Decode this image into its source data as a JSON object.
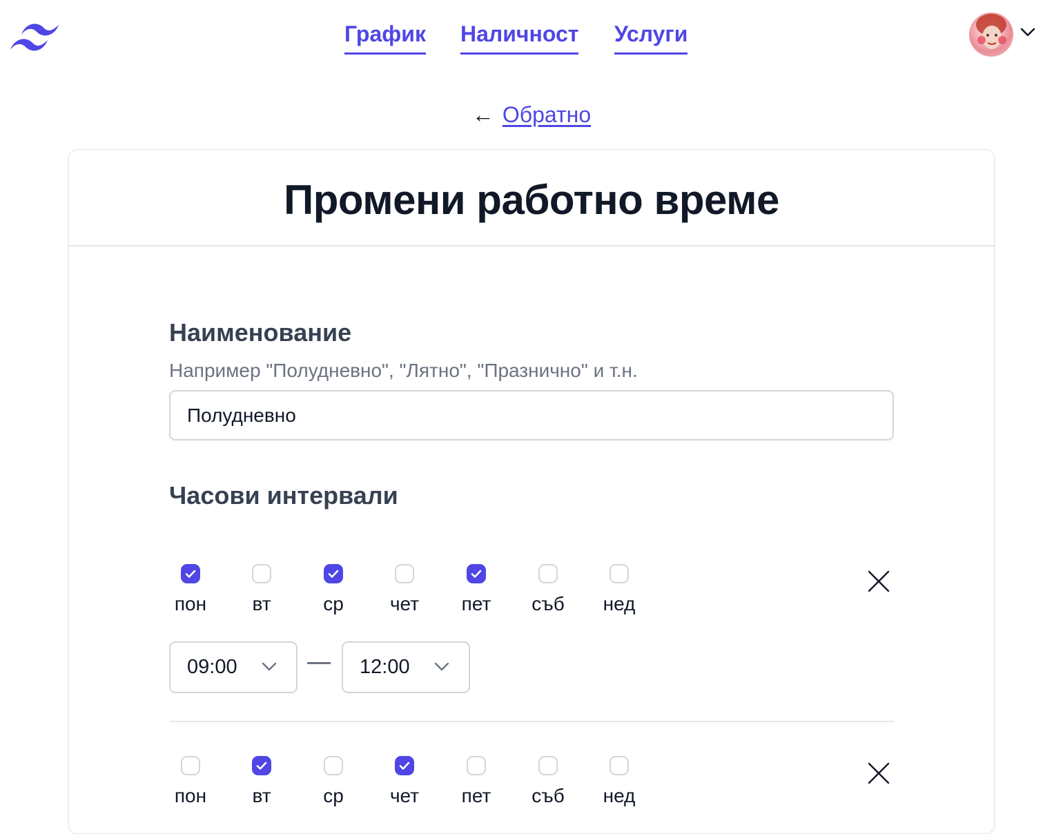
{
  "nav": {
    "items": [
      "График",
      "Наличност",
      "Услуги"
    ]
  },
  "back": {
    "arrow": "←",
    "label": "Обратно"
  },
  "card": {
    "title": "Промени работно време"
  },
  "form": {
    "name_label": "Наименование",
    "name_hint": "Например \"Полудневно\", \"Лятно\", \"Празнично\" и т.н.",
    "name_value": "Полудневно",
    "intervals_label": "Часови интервали"
  },
  "days": [
    "пон",
    "вт",
    "ср",
    "чет",
    "пет",
    "съб",
    "нед"
  ],
  "intervals": [
    {
      "checked": [
        true,
        false,
        true,
        false,
        true,
        false,
        false
      ],
      "from": "09:00",
      "to": "12:00"
    },
    {
      "checked": [
        false,
        true,
        false,
        true,
        false,
        false,
        false
      ]
    }
  ],
  "colors": {
    "accent": "#4f46e5",
    "text": "#111827",
    "muted": "#6b7280",
    "border": "#d1d5db"
  }
}
